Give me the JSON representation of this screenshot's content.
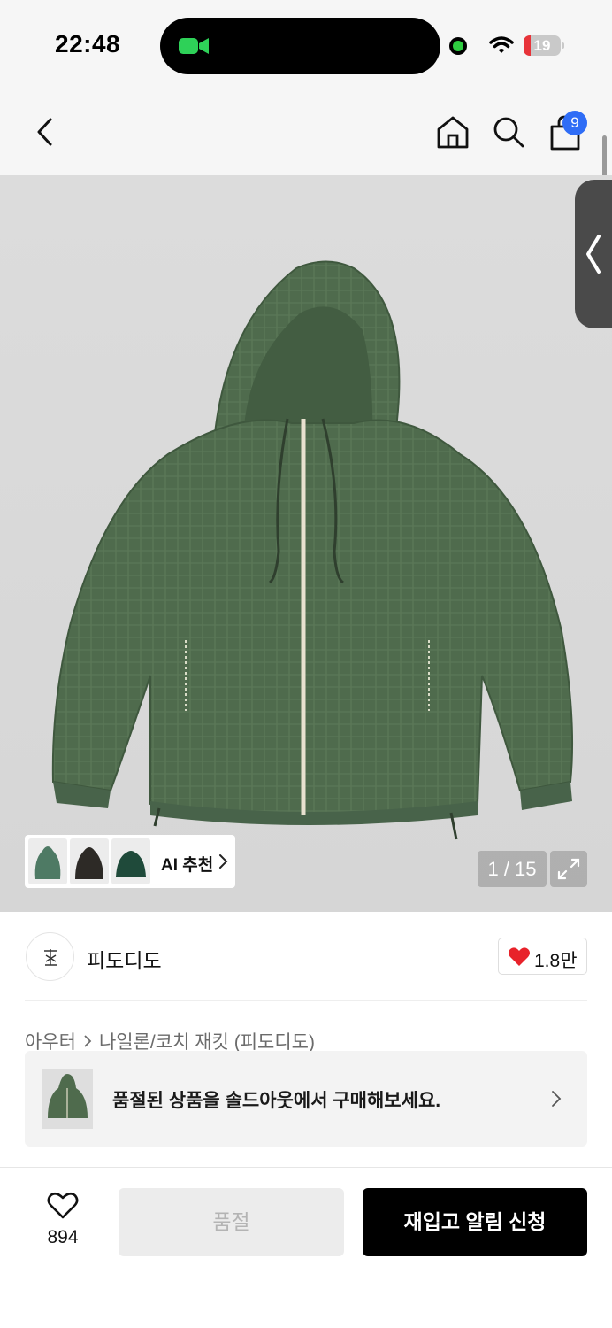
{
  "status_bar": {
    "time": "22:48",
    "battery_percent": "19",
    "battery_level": 0.19,
    "icons": [
      "facetime-camera-icon",
      "mic-dot-icon",
      "wifi-icon",
      "battery-icon"
    ]
  },
  "nav": {
    "icons": [
      "back-icon",
      "home-icon",
      "search-icon",
      "cart-icon"
    ],
    "cart_badge": "9"
  },
  "product_image": {
    "page_counter": "1 / 15",
    "ai_recommend": {
      "label": "AI 추천",
      "thumbnail_colors": [
        "#4e7a64",
        "#2d2a26",
        "#1f4a3a"
      ]
    },
    "jacket_color": "#4f6b4d"
  },
  "brand": {
    "name": "피도디도",
    "likes": "1.8만"
  },
  "breadcrumb": {
    "category": "아우터",
    "subcategory": "나일론/코치 재킷 (피도디도)"
  },
  "soldout_banner": {
    "text": "품절된 상품을 솔드아웃에서 구매해보세요."
  },
  "bottom_bar": {
    "wish_count": "894",
    "soldout_label": "품절",
    "restock_label": "재입고 알림 신청"
  },
  "colors": {
    "accent_blue": "#2f6df6",
    "heart_red": "#e8222a",
    "primary_button": "#000000",
    "disabled_button": "#ececec"
  }
}
